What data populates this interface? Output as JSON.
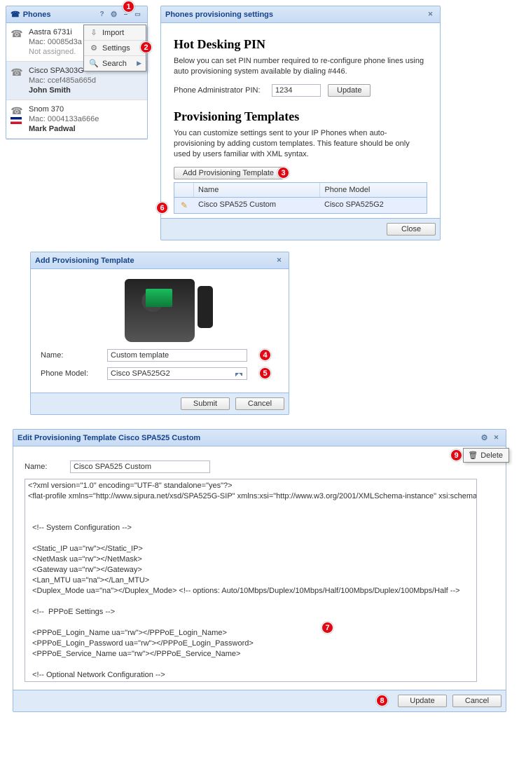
{
  "phones_panel": {
    "title": "Phones",
    "items": [
      {
        "model": "Aastra 6731i",
        "mac": "Mac: 00085d3a",
        "owner": "Not assigned.",
        "assigned": false
      },
      {
        "model": "Cisco SPA303G",
        "mac": "Mac: ccef485a665d",
        "owner": "John Smith",
        "assigned": true,
        "selected": true
      },
      {
        "model": "Snom 370",
        "mac": "Mac: 0004133a666e",
        "owner": "Mark Padwal",
        "assigned": true,
        "flag": true
      }
    ],
    "menu": {
      "import": "Import",
      "settings": "Settings",
      "search": "Search"
    }
  },
  "settings_panel": {
    "title": "Phones provisioning settings",
    "hotdesk_heading": "Hot Desking PIN",
    "hotdesk_desc": "Below you can set PIN number required to re-configure phone lines using auto provisioning system available by dialing #446.",
    "pin_label": "Phone Administrator PIN:",
    "pin_value": "1234",
    "update_label": "Update",
    "templates_heading": "Provisioning Templates",
    "templates_desc": "You can customize settings sent to your IP Phones when auto-provisioning by adding custom templates. This feature should be only used by users familiar with XML syntax.",
    "add_template_label": "Add Provisioning Template",
    "grid": {
      "col_name": "Name",
      "col_model": "Phone Model",
      "row": {
        "name": "Cisco SPA525 Custom",
        "model": "Cisco SPA525G2"
      }
    },
    "close_label": "Close"
  },
  "add_dialog": {
    "title": "Add Provisioning Template",
    "name_label": "Name:",
    "name_value": "Custom template",
    "model_label": "Phone Model:",
    "model_value": "Cisco SPA525G2",
    "submit_label": "Submit",
    "cancel_label": "Cancel"
  },
  "edit_panel": {
    "title": "Edit Provisioning Template Cisco SPA525 Custom",
    "name_label": "Name:",
    "name_value": "Cisco SPA525 Custom",
    "delete_label": "Delete",
    "update_label": "Update",
    "cancel_label": "Cancel",
    "xml": "<?xml version=\"1.0\" encoding=\"UTF-8\" standalone=\"yes\"?>\n<flat-profile xmlns=\"http://www.sipura.net/xsd/SPA525G-SIP\" xmlns:xsi=\"http://www.w3.org/2001/XMLSchema-instance\" xsi:schemaLocation=\"http://www.sipura.net/xsd/SPA525G-SIP http://www.sipura.net/xsd/SPA525G-SIP/SPA525G-SIP-7-4-7.xsd\">\n\n\n  <!-- System Configuration -->\n\n  <Static_IP ua=\"rw\"></Static_IP>\n  <NetMask ua=\"rw\"></NetMask>\n  <Gateway ua=\"rw\"></Gateway>\n  <Lan_MTU ua=\"na\"></Lan_MTU>\n  <Duplex_Mode ua=\"na\"></Duplex_Mode> <!-- options: Auto/10Mbps/Duplex/10Mbps/Half/100Mbps/Duplex/100Mbps/Half -->\n\n  <!--  PPPoE Settings -->\n\n  <PPPoE_Login_Name ua=\"rw\"></PPPoE_Login_Name>\n  <PPPoE_Login_Password ua=\"rw\"></PPPoE_Login_Password>\n  <PPPoE_Service_Name ua=\"rw\"></PPPoE_Service_Name>\n\n  <!-- Optional Network Configuration -->"
  },
  "callouts": [
    "1",
    "2",
    "3",
    "4",
    "5",
    "6",
    "7",
    "8",
    "9"
  ]
}
